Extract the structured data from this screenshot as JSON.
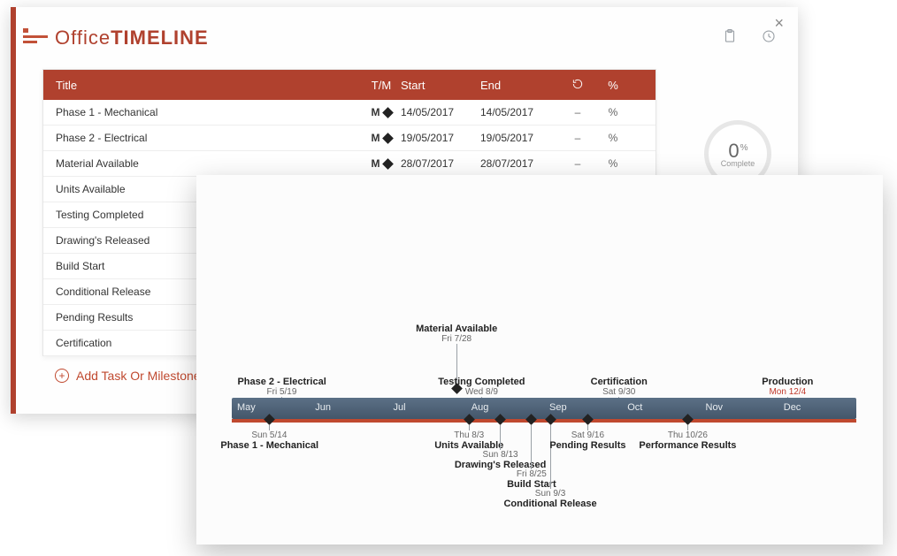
{
  "brand": {
    "thin": "Office",
    "bold": "TIMELINE"
  },
  "close": "×",
  "columns": {
    "title": "Title",
    "tm": "T/M",
    "start": "Start",
    "end": "End",
    "pct": "%"
  },
  "rows": [
    {
      "title": "Phase 1 - Mechanical",
      "tm": "M",
      "start": "14/05/2017",
      "end": "14/05/2017",
      "rec": "–",
      "pct": "%"
    },
    {
      "title": "Phase 2 - Electrical",
      "tm": "M",
      "start": "19/05/2017",
      "end": "19/05/2017",
      "rec": "–",
      "pct": "%"
    },
    {
      "title": "Material Available",
      "tm": "M",
      "start": "28/07/2017",
      "end": "28/07/2017",
      "rec": "–",
      "pct": "%"
    },
    {
      "title": "Units Available"
    },
    {
      "title": "Testing Completed"
    },
    {
      "title": "Drawing's Released"
    },
    {
      "title": "Build Start"
    },
    {
      "title": "Conditional Release"
    },
    {
      "title": "Pending Results"
    },
    {
      "title": "Certification"
    }
  ],
  "addLabel": "Add Task Or Milestone",
  "ring": {
    "value": "0",
    "unit": "%",
    "label": "Complete"
  },
  "timeline": {
    "months": [
      {
        "label": "May",
        "pos": 0
      },
      {
        "label": "Jun",
        "pos": 12.5
      },
      {
        "label": "Jul",
        "pos": 25
      },
      {
        "label": "Aug",
        "pos": 37.5
      },
      {
        "label": "Sep",
        "pos": 50
      },
      {
        "label": "Oct",
        "pos": 62.5
      },
      {
        "label": "Nov",
        "pos": 75
      },
      {
        "label": "Dec",
        "pos": 87.5
      }
    ],
    "above": [
      {
        "name": "Phase 2 - Electrical",
        "date": "Fri 5/19",
        "pos": 8,
        "row": 1
      },
      {
        "name": "Material Available",
        "date": "Fri 7/28",
        "pos": 36,
        "row": 2
      },
      {
        "name": "Testing Completed",
        "date": "Wed 8/9",
        "pos": 40,
        "row": 1
      },
      {
        "name": "Certification",
        "date": "Sat 9/30",
        "pos": 62,
        "row": 1
      },
      {
        "name": "Production",
        "date": "Mon 12/4",
        "pos": 89,
        "row": 1,
        "red": true
      }
    ],
    "below": [
      {
        "name": "Phase 1 - Mechanical",
        "date": "Sun 5/14",
        "pos": 6,
        "row": 1
      },
      {
        "name": "Units Available",
        "date": "Thu 8/3",
        "pos": 38,
        "row": 1
      },
      {
        "name": "Drawing's Released",
        "date": "Sun 8/13",
        "pos": 43,
        "row": 2
      },
      {
        "name": "Build Start",
        "date": "Fri 8/25",
        "pos": 48,
        "row": 3
      },
      {
        "name": "Conditional Release",
        "date": "Sun 9/3",
        "pos": 51,
        "row": 4
      },
      {
        "name": "Pending Results",
        "date": "Sat 9/16",
        "pos": 57,
        "row": 1
      },
      {
        "name": "Performance Results",
        "date": "Thu 10/26",
        "pos": 73,
        "row": 1
      }
    ]
  },
  "chart_data": {
    "type": "timeline",
    "title": "",
    "x_axis": [
      "May",
      "Jun",
      "Jul",
      "Aug",
      "Sep",
      "Oct",
      "Nov",
      "Dec"
    ],
    "milestones": [
      {
        "label": "Phase 1 - Mechanical",
        "date": "Sun 5/14"
      },
      {
        "label": "Phase 2 - Electrical",
        "date": "Fri 5/19"
      },
      {
        "label": "Material Available",
        "date": "Fri 7/28"
      },
      {
        "label": "Units Available",
        "date": "Thu 8/3"
      },
      {
        "label": "Testing Completed",
        "date": "Wed 8/9"
      },
      {
        "label": "Drawing's Released",
        "date": "Sun 8/13"
      },
      {
        "label": "Build Start",
        "date": "Fri 8/25"
      },
      {
        "label": "Conditional Release",
        "date": "Sun 9/3"
      },
      {
        "label": "Pending Results",
        "date": "Sat 9/16"
      },
      {
        "label": "Certification",
        "date": "Sat 9/30"
      },
      {
        "label": "Performance Results",
        "date": "Thu 10/26"
      },
      {
        "label": "Production",
        "date": "Mon 12/4",
        "highlight": true
      }
    ]
  }
}
